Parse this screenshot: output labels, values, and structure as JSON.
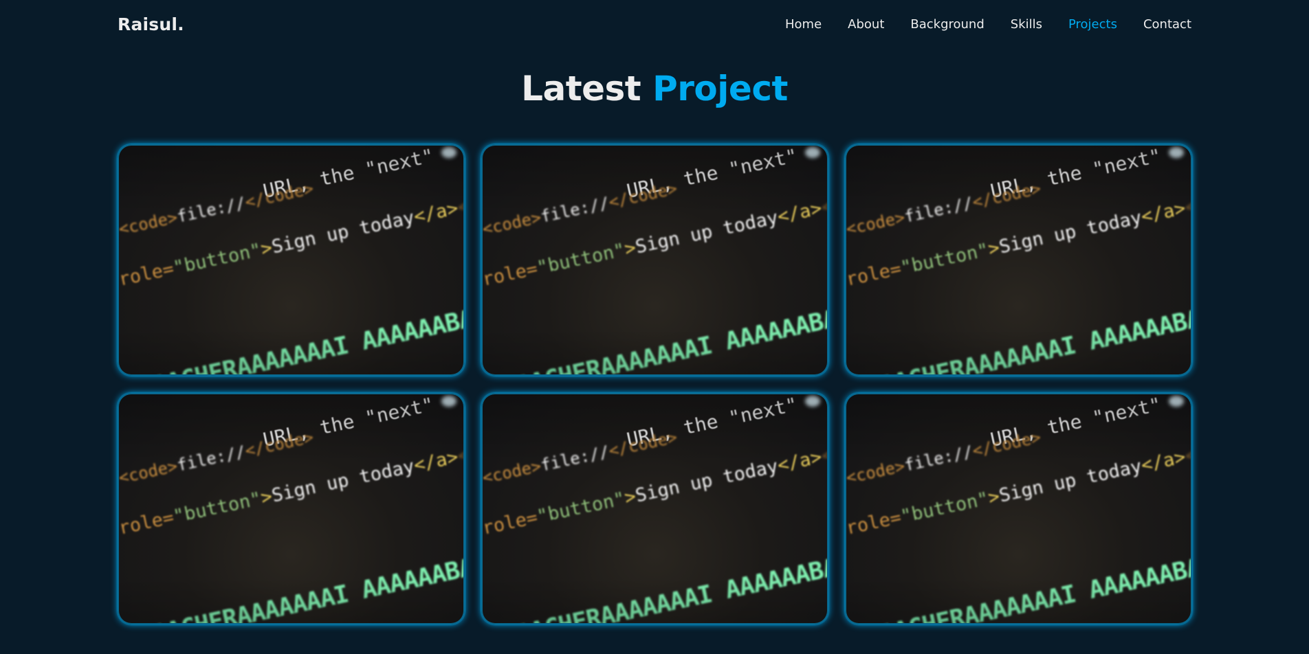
{
  "header": {
    "logo": "Raisul.",
    "nav": [
      {
        "label": "Home",
        "active": false
      },
      {
        "label": "About",
        "active": false
      },
      {
        "label": "Background",
        "active": false
      },
      {
        "label": "Skills",
        "active": false
      },
      {
        "label": "Projects",
        "active": true
      },
      {
        "label": "Contact",
        "active": false
      }
    ]
  },
  "section": {
    "title_main": "Latest",
    "title_accent": "Project"
  },
  "projects": [
    {
      "image": "code-screenshot"
    },
    {
      "image": "code-screenshot"
    },
    {
      "image": "code-screenshot"
    },
    {
      "image": "code-screenshot"
    },
    {
      "image": "code-screenshot"
    },
    {
      "image": "code-screenshot"
    }
  ],
  "code_image_text": {
    "line1": "URL, the \"next\"",
    "line2_tag_open": "<code>",
    "line2_text": "file://",
    "line2_tag_close": "</code>",
    "line3_attr": "role=",
    "line3_value": "\"button\"",
    "line3_gt": ">",
    "line3_text": "Sign up today",
    "line3_close": "</a>",
    "line3_dim": "</p>",
    "line4": "AACHERAAAAAAAI AAAAAABAAEAAAICR"
  },
  "colors": {
    "background": "#081b29",
    "accent": "#00abf0",
    "text": "#ededed"
  }
}
